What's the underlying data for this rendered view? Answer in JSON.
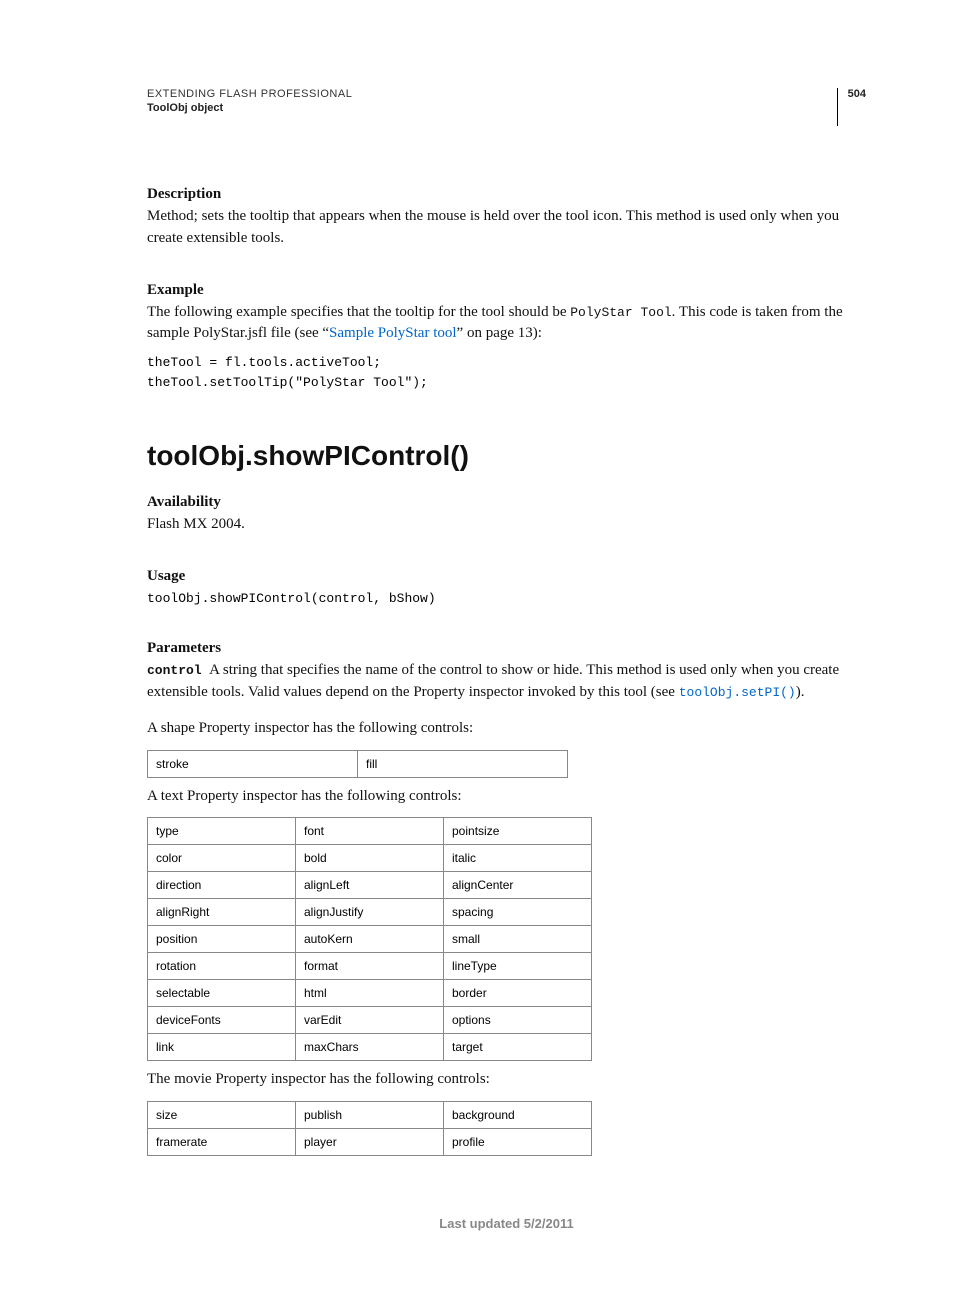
{
  "header": {
    "title": "EXTENDING FLASH PROFESSIONAL",
    "subtitle": "ToolObj object",
    "page_number": "504"
  },
  "section1": {
    "heading": "Description",
    "body": "Method; sets the tooltip that appears when the mouse is held over the tool icon. This method is used only when you create extensible tools."
  },
  "section2": {
    "heading": "Example",
    "body_pre": "The following example specifies that the tooltip for the tool should be ",
    "body_code": "PolyStar Tool",
    "body_mid": ". This code is taken from the sample PolyStar.jsfl file (see “",
    "body_link": "Sample PolyStar tool",
    "body_post": "” on page 13):",
    "code": "theTool = fl.tools.activeTool;\ntheTool.setToolTip(\"PolyStar Tool\");"
  },
  "api_heading": "toolObj.showPIControl()",
  "availability": {
    "heading": "Availability",
    "body": "Flash MX 2004."
  },
  "usage": {
    "heading": "Usage",
    "code": "toolObj.showPIControl(control, bShow)"
  },
  "parameters": {
    "heading": "Parameters",
    "term": "control",
    "p1a": "A string that specifies the name of the control to show or hide. This method is used only when you create extensible tools. Valid values depend on the Property inspector invoked by this tool (see ",
    "p1_link": "toolObj.setPI()",
    "p1b": ").",
    "shape_intro": "A shape Property inspector has the following controls:",
    "shape_table": [
      [
        "stroke",
        "fill"
      ]
    ],
    "text_intro": "A text Property inspector has the following controls:",
    "text_table": [
      [
        "type",
        "font",
        "pointsize"
      ],
      [
        "color",
        "bold",
        "italic"
      ],
      [
        "direction",
        "alignLeft",
        "alignCenter"
      ],
      [
        "alignRight",
        "alignJustify",
        "spacing"
      ],
      [
        "position",
        "autoKern",
        "small"
      ],
      [
        "rotation",
        "format",
        "lineType"
      ],
      [
        "selectable",
        "html",
        "border"
      ],
      [
        "deviceFonts",
        "varEdit",
        "options"
      ],
      [
        "link",
        "maxChars",
        "target"
      ]
    ],
    "movie_intro": "The movie Property inspector has the following controls:",
    "movie_table": [
      [
        "size",
        "publish",
        "background"
      ],
      [
        "framerate",
        "player",
        "profile"
      ]
    ]
  },
  "footer": "Last updated 5/2/2011"
}
